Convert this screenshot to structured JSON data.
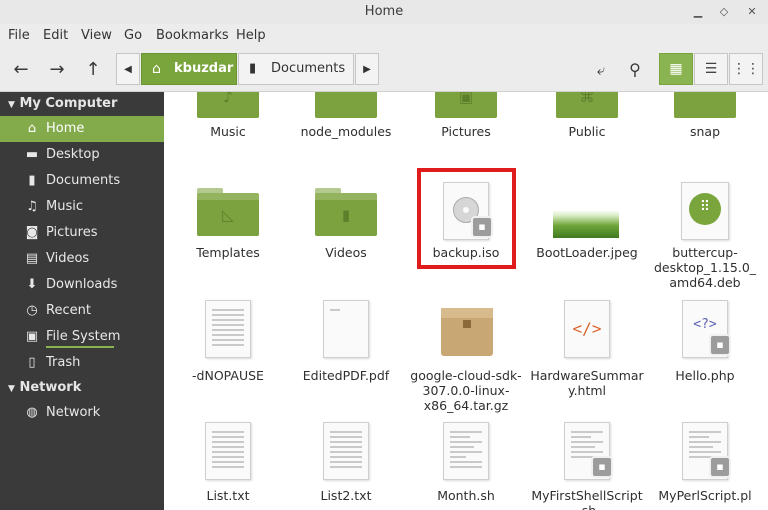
{
  "window": {
    "title": "Home"
  },
  "menu": [
    "File",
    "Edit",
    "View",
    "Go",
    "Bookmarks",
    "Help"
  ],
  "toolbar": {
    "path": [
      "kbuzdar",
      "Documents"
    ]
  },
  "sidebar": {
    "sections": [
      {
        "title": "My Computer"
      },
      {
        "title": "Network"
      }
    ],
    "items": [
      {
        "label": "Home",
        "icon": "home-icon"
      },
      {
        "label": "Desktop",
        "icon": "desktop-icon"
      },
      {
        "label": "Documents",
        "icon": "documents-icon"
      },
      {
        "label": "Music",
        "icon": "music-icon"
      },
      {
        "label": "Pictures",
        "icon": "camera-icon"
      },
      {
        "label": "Videos",
        "icon": "film-icon"
      },
      {
        "label": "Downloads",
        "icon": "download-icon"
      },
      {
        "label": "Recent",
        "icon": "clock-icon"
      },
      {
        "label": "File System",
        "icon": "drive-icon"
      },
      {
        "label": "Trash",
        "icon": "trash-icon"
      },
      {
        "label": "Network",
        "icon": "globe-icon"
      }
    ]
  },
  "files": {
    "row1": [
      "Music",
      "node_modules",
      "Pictures",
      "Public",
      "snap"
    ],
    "row2": [
      "Templates",
      "Videos",
      "backup.iso",
      "BootLoader.jpeg",
      "buttercup-\ndesktop_1.15.0_\namd64.deb"
    ],
    "row3": [
      "-dNOPAUSE",
      "EditedPDF.pdf",
      "google-cloud-sdk-\n307.0.0-linux-\nx86_64.tar.gz",
      "HardwareSummar\ny.html",
      "Hello.php"
    ],
    "row4": [
      "List.txt",
      "List2.txt",
      "Month.sh",
      "MyFirstShellScript\n.sh",
      "MyPerlScript.pl"
    ]
  }
}
